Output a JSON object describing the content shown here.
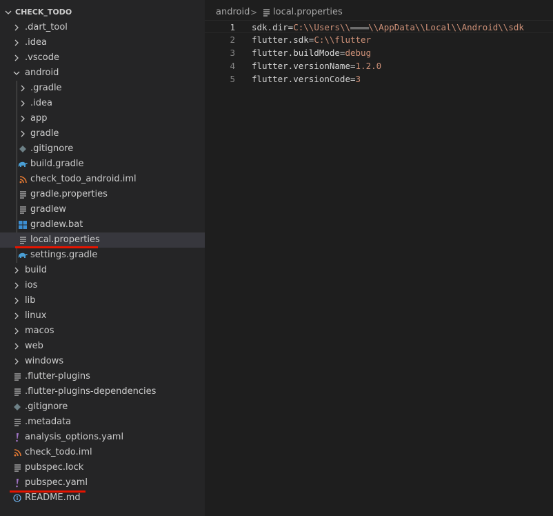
{
  "explorer": {
    "root_title": "CHECK_TODO",
    "items": [
      {
        "label": ".dart_tool",
        "kind": "folder",
        "icon": "chevron-right-icon"
      },
      {
        "label": ".idea",
        "kind": "folder",
        "icon": "chevron-right-icon"
      },
      {
        "label": ".vscode",
        "kind": "folder",
        "icon": "chevron-right-icon"
      },
      {
        "label": "android",
        "kind": "folder-open",
        "icon": "chevron-down-icon"
      },
      {
        "label": ".gradle",
        "kind": "folder",
        "icon": "chevron-right-icon"
      },
      {
        "label": ".idea",
        "kind": "folder",
        "icon": "chevron-right-icon"
      },
      {
        "label": "app",
        "kind": "folder",
        "icon": "chevron-right-icon"
      },
      {
        "label": "gradle",
        "kind": "folder",
        "icon": "chevron-right-icon"
      },
      {
        "label": ".gitignore",
        "kind": "file",
        "icon": "git-diamond-icon"
      },
      {
        "label": "build.gradle",
        "kind": "file",
        "icon": "gradle-elephant-icon"
      },
      {
        "label": "check_todo_android.iml",
        "kind": "file",
        "icon": "rss-icon"
      },
      {
        "label": "gradle.properties",
        "kind": "file",
        "icon": "lines-icon"
      },
      {
        "label": "gradlew",
        "kind": "file",
        "icon": "lines-icon"
      },
      {
        "label": "gradlew.bat",
        "kind": "file",
        "icon": "windows-icon"
      },
      {
        "label": "local.properties",
        "kind": "file",
        "icon": "lines-icon",
        "selected": true
      },
      {
        "label": "settings.gradle",
        "kind": "file",
        "icon": "gradle-elephant-icon"
      },
      {
        "label": "build",
        "kind": "folder",
        "icon": "chevron-right-icon"
      },
      {
        "label": "ios",
        "kind": "folder",
        "icon": "chevron-right-icon"
      },
      {
        "label": "lib",
        "kind": "folder",
        "icon": "chevron-right-icon"
      },
      {
        "label": "linux",
        "kind": "folder",
        "icon": "chevron-right-icon"
      },
      {
        "label": "macos",
        "kind": "folder",
        "icon": "chevron-right-icon"
      },
      {
        "label": "web",
        "kind": "folder",
        "icon": "chevron-right-icon"
      },
      {
        "label": "windows",
        "kind": "folder",
        "icon": "chevron-right-icon"
      },
      {
        "label": ".flutter-plugins",
        "kind": "file",
        "icon": "lines-icon"
      },
      {
        "label": ".flutter-plugins-dependencies",
        "kind": "file",
        "icon": "lines-icon"
      },
      {
        "label": ".gitignore",
        "kind": "file",
        "icon": "git-diamond-icon"
      },
      {
        "label": ".metadata",
        "kind": "file",
        "icon": "lines-icon"
      },
      {
        "label": "analysis_options.yaml",
        "kind": "file",
        "icon": "exclamation-icon"
      },
      {
        "label": "check_todo.iml",
        "kind": "file",
        "icon": "rss-icon"
      },
      {
        "label": "pubspec.lock",
        "kind": "file",
        "icon": "lines-icon"
      },
      {
        "label": "pubspec.yaml",
        "kind": "file",
        "icon": "exclamation-icon"
      },
      {
        "label": "README.md",
        "kind": "file",
        "icon": "info-icon"
      }
    ]
  },
  "editor": {
    "breadcrumb": {
      "folder": "android",
      "separator": ">",
      "file": "local.properties"
    },
    "lines": [
      {
        "num": "1",
        "key": "sdk.dir=",
        "value_a": "C:\\\\Users\\\\",
        "value_blur": "▬▬▬▬",
        "value_b": "\\\\AppData\\\\Local\\\\Android\\\\sdk"
      },
      {
        "num": "2",
        "key": "flutter.sdk=",
        "value_a": "C:\\\\flutter",
        "value_blur": "",
        "value_b": ""
      },
      {
        "num": "3",
        "key": "flutter.buildMode=",
        "value_a": "debug",
        "value_blur": "",
        "value_b": ""
      },
      {
        "num": "4",
        "key": "flutter.versionName=",
        "value_a": "1.2.0",
        "value_blur": "",
        "value_b": ""
      },
      {
        "num": "5",
        "key": "flutter.versionCode=",
        "value_a": "3",
        "value_blur": "",
        "value_b": ""
      }
    ]
  },
  "colors": {
    "sidebar_bg": "#252526",
    "editor_bg": "#1e1e1e",
    "selection_bg": "#37373d",
    "annotation_red": "#e51400",
    "string_value": "#ce9178",
    "gradle_blue": "#4a9fd5",
    "rss_orange": "#e37933",
    "yaml_purple": "#a074c4",
    "windows_blue": "#3c8ed2",
    "git_gray": "#6d8086"
  }
}
